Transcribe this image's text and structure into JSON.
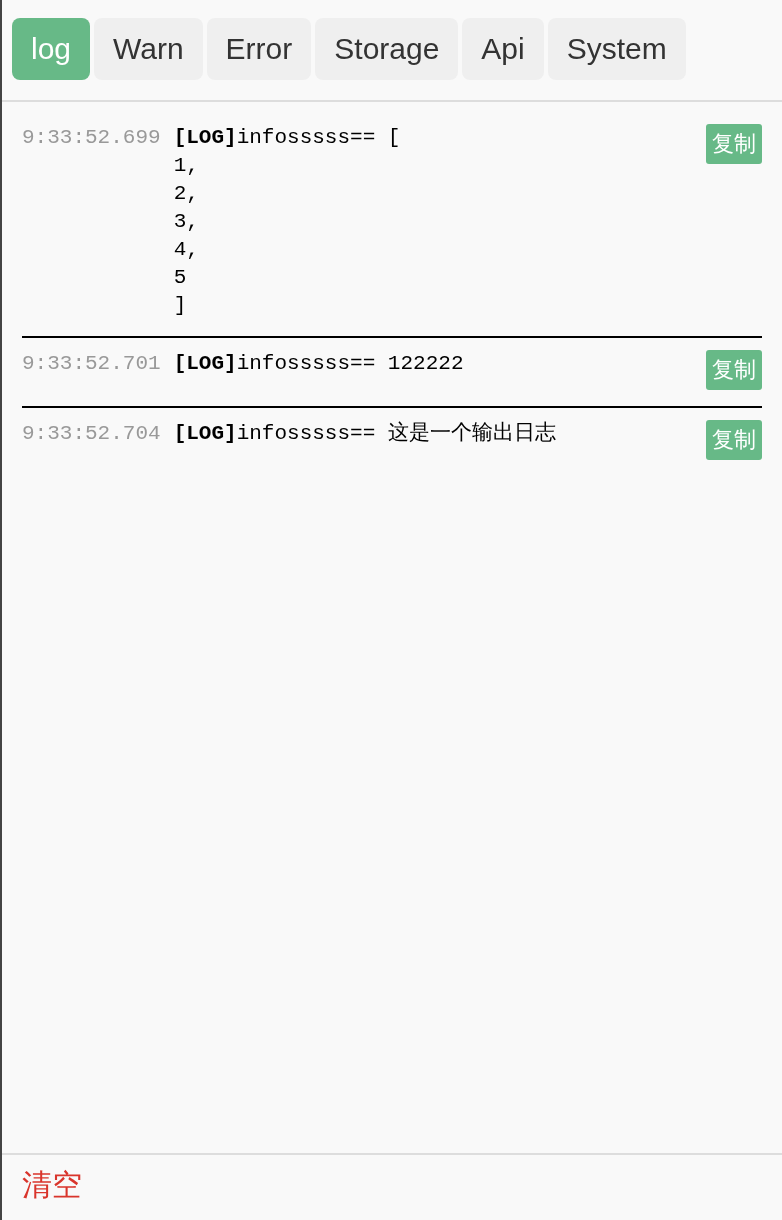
{
  "tabs": [
    {
      "label": "log",
      "selected": true
    },
    {
      "label": "Warn",
      "selected": false
    },
    {
      "label": "Error",
      "selected": false
    },
    {
      "label": "Storage",
      "selected": false
    },
    {
      "label": "Api",
      "selected": false
    },
    {
      "label": "System",
      "selected": false
    }
  ],
  "entries": [
    {
      "time": "9:33:52.699",
      "message": "**[LOG]**infosssss== [\n1,\n2,\n3,\n4,\n5\n]",
      "copy_button": "复制"
    },
    {
      "time": "9:33:52.701",
      "message": "**[LOG]**infosssss== 122222",
      "copy_button": "复制"
    },
    {
      "time": "9:33:52.704",
      "message": "**[LOG]**infosssss== 这是一个输出日志",
      "copy_button": "复制"
    }
  ],
  "clear_button": "清空"
}
